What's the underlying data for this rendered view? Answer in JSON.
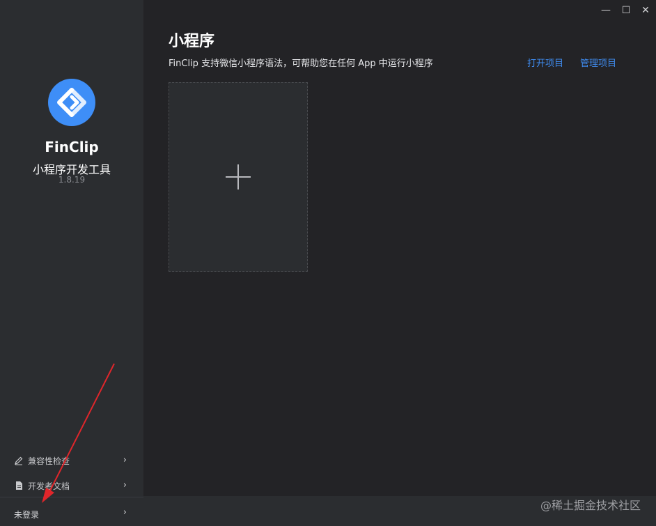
{
  "window": {
    "minimize_glyph": "—",
    "maximize_glyph": "☐",
    "close_glyph": "✕"
  },
  "sidebar": {
    "app_name": "FinClip",
    "app_subtitle": "小程序开发工具",
    "version": "1.8.19",
    "menu": [
      {
        "label": "兼容性检查",
        "icon": "pencil-icon"
      },
      {
        "label": "开发者文档",
        "icon": "document-icon"
      }
    ],
    "login_label": "未登录",
    "chevron": "›"
  },
  "main": {
    "title": "小程序",
    "description": "FinClip 支持微信小程序语法，可帮助您在任何 App 中运行小程序",
    "open_project": "打开项目",
    "manage_project": "管理项目"
  },
  "watermark": "@稀土掘金技术社区",
  "colors": {
    "accent": "#3f8cf0",
    "logo": "#3e8ef7",
    "annotation_arrow": "#e0262b"
  }
}
